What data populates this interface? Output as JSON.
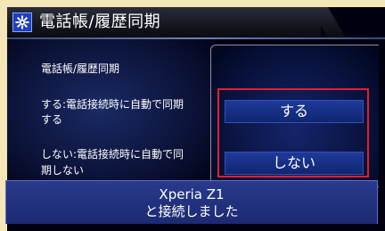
{
  "header": {
    "title": "電話帳/履歴同期",
    "logo_icon": "gear-logo-icon"
  },
  "help": {
    "heading": "電話帳/履歴同期",
    "on_line1": "する:電話接続時に自動で同期",
    "on_line2": "する",
    "off_line1": "しない:電話接続時に自動で同",
    "off_line2": "期しない"
  },
  "options": [
    {
      "label": "する",
      "selected": true
    },
    {
      "label": "しない",
      "selected": false
    }
  ],
  "message": {
    "line1": "Xperia Z1",
    "line2": "と接続しました"
  },
  "colors": {
    "frame": "#f5e6b8",
    "background": "#000010",
    "highlight": "#e0202c",
    "button": "#1e3a9a"
  }
}
